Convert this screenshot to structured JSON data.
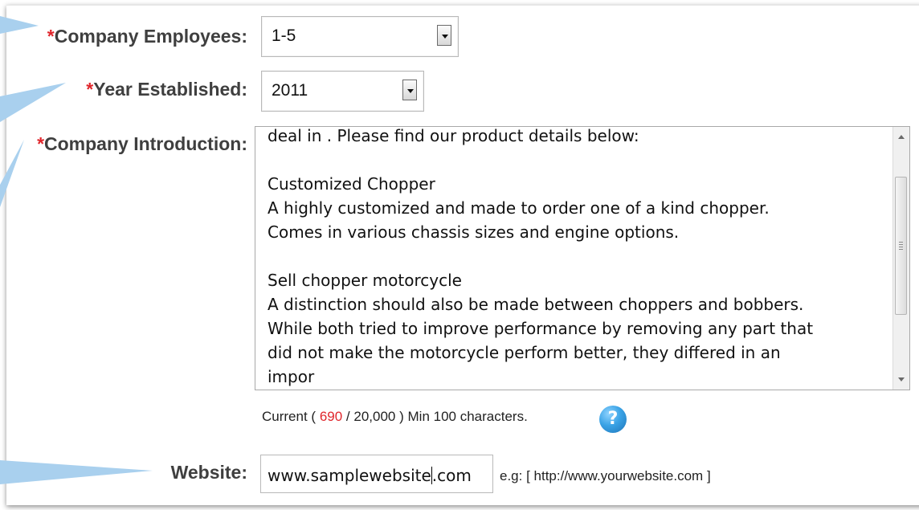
{
  "fields": {
    "employees": {
      "required_mark": "*",
      "label": "Company Employees:",
      "value": "1-5"
    },
    "year": {
      "required_mark": "*",
      "label": "Year Established:",
      "value": "2011"
    },
    "introduction": {
      "required_mark": "*",
      "label": "Company Introduction:",
      "text": "deal in . Please find our product details below:\n\nCustomized Chopper\nA highly customized and made to order one of a kind chopper.\nComes in various chassis sizes and engine options.\n\nSell chopper motorcycle\nA distinction should also be made between choppers and bobbers.\nWhile both tried to improve performance by removing any part that\ndid not make the motorcycle perform better, they differed in an\nimpor",
      "counter_prefix": "Current (",
      "counter_current": "690",
      "counter_sep": "/",
      "counter_max": "20,000",
      "counter_suffix": ") Min 100 characters."
    },
    "website": {
      "label": "Website:",
      "value_before_caret": "www.samplewebsite",
      "value_after_caret": ".com",
      "example": "e.g: [ http://www.yourwebsite.com ]"
    }
  },
  "icons": {
    "help": "question-mark-icon"
  },
  "colors": {
    "required": "#e0262c",
    "callout": "#a9d0ee",
    "help_icon": "#3aa3e6"
  }
}
